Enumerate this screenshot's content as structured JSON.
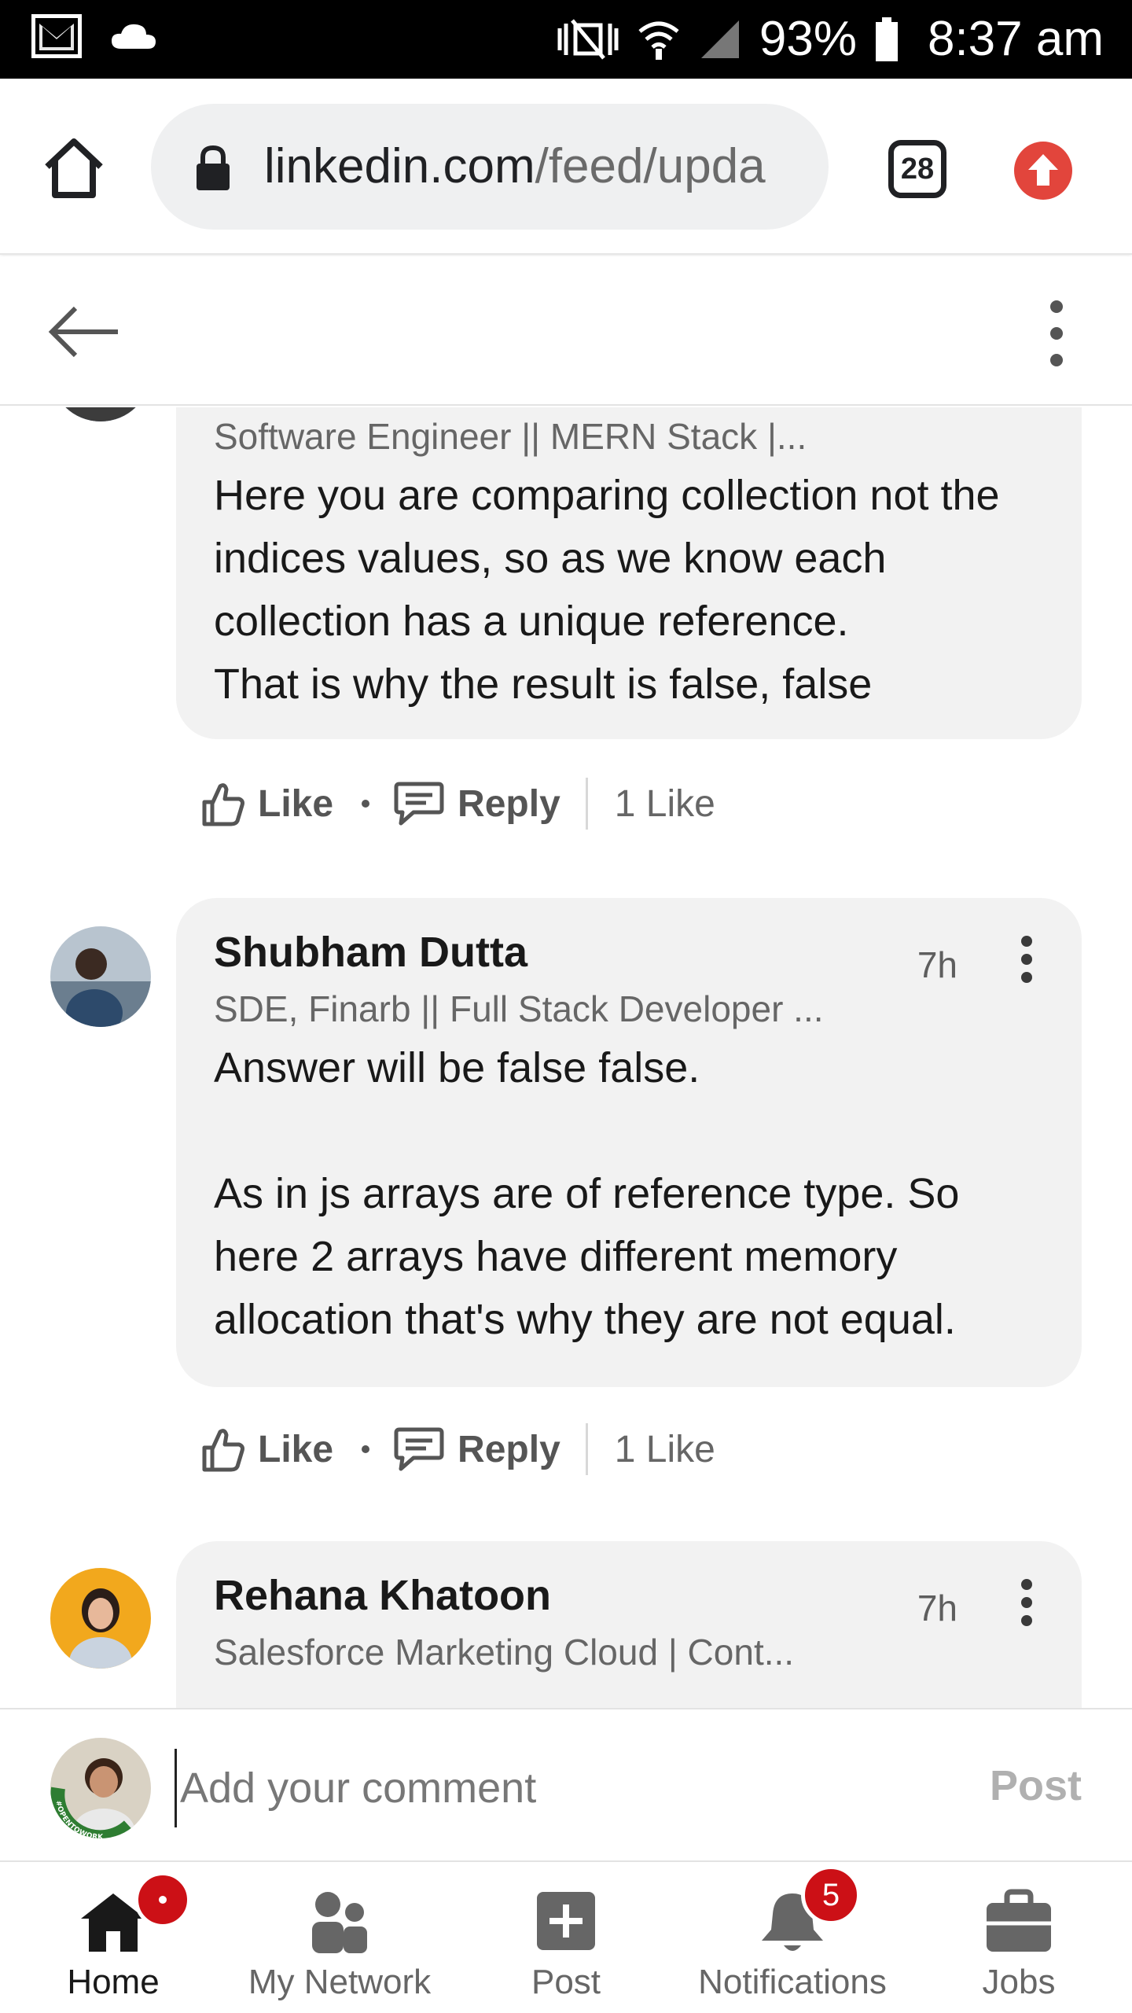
{
  "status_bar": {
    "battery": "93%",
    "time": "8:37 am",
    "icons": [
      "gmail-icon",
      "cloud-icon",
      "vibrate-icon",
      "wifi-icon",
      "signal-icon",
      "battery-icon"
    ]
  },
  "browser": {
    "url": "linkedin.com/feed/upda",
    "url_domain": "linkedin.com",
    "url_path": "/feed/upda",
    "tab_count": "28"
  },
  "comments": [
    {
      "headline": "Software Engineer || MERN Stack |...",
      "body": [
        "Here you are comparing collection not the indices values, so as we know each collection has a unique reference.",
        "That is why the result is false, false"
      ],
      "like_label": "Like",
      "reply_label": "Reply",
      "likes": "1 Like"
    },
    {
      "name": "Shubham Dutta",
      "time": "7h",
      "headline": "SDE, Finarb || Full Stack Developer ...",
      "body": [
        "Answer will be false false.",
        "",
        "As in js arrays are of reference type. So here 2 arrays have different memory allocation that's why they are not equal."
      ],
      "like_label": "Like",
      "reply_label": "Reply",
      "likes": "1 Like"
    },
    {
      "name": "Rehana Khatoon",
      "time": "7h",
      "headline": "Salesforce Marketing Cloud | Cont..."
    }
  ],
  "composer": {
    "placeholder": "Add your comment",
    "post_label": "Post",
    "avatar_ribbon": "#OPENTOWORK"
  },
  "bottom_nav": [
    {
      "label": "Home",
      "icon": "home-icon",
      "active": true
    },
    {
      "label": "My Network",
      "icon": "network-icon"
    },
    {
      "label": "Post",
      "icon": "post-icon"
    },
    {
      "label": "Notifications",
      "icon": "bell-icon",
      "badge": "5"
    },
    {
      "label": "Jobs",
      "icon": "briefcase-icon"
    }
  ],
  "colors": {
    "badge_red": "#cc1016",
    "card_bg": "#f2f2f2",
    "update_red": "#e2453c",
    "text_primary": "#191919",
    "text_secondary": "#666666"
  }
}
